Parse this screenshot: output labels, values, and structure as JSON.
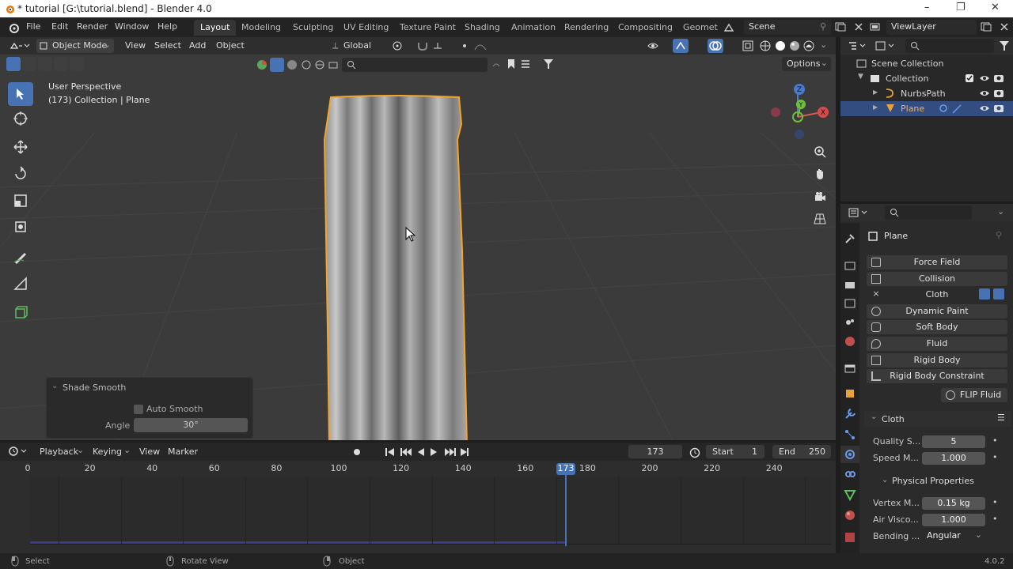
{
  "window": {
    "title": "* tutorial [G:\\tutorial.blend] - Blender 4.0",
    "controls": [
      "–",
      "❐",
      "✕"
    ]
  },
  "menubar": {
    "menus": [
      "File",
      "Edit",
      "Render",
      "Window",
      "Help"
    ],
    "workspaces": [
      "Layout",
      "Modeling",
      "Sculpting",
      "UV Editing",
      "Texture Paint",
      "Shading",
      "Animation",
      "Rendering",
      "Compositing",
      "Geomet"
    ],
    "active_workspace": "Layout",
    "scene": "Scene",
    "view_layer": "ViewLayer"
  },
  "viewport_header": {
    "mode": "Object Mode",
    "menus": [
      "View",
      "Select",
      "Add",
      "Object"
    ],
    "orientation": "Global",
    "options": "Options"
  },
  "viewport": {
    "perspective_label": "User Perspective",
    "collection_label": "(173) Collection | Plane",
    "gizmo_axes": {
      "x": "X",
      "y": "Y",
      "z": "Z"
    },
    "accent_color": "#4772b3",
    "selection_color": "#f5a42a"
  },
  "redo_panel": {
    "title": "Shade Smooth",
    "auto_smooth_label": "Auto Smooth",
    "auto_smooth_checked": false,
    "angle_label": "Angle",
    "angle_value": "30°"
  },
  "outliner": {
    "rows": [
      {
        "label": "Scene Collection",
        "type": "scene-collection"
      },
      {
        "label": "Collection",
        "type": "collection"
      },
      {
        "label": "NurbsPath",
        "type": "curve"
      },
      {
        "label": "Plane",
        "type": "mesh",
        "selected": true
      }
    ]
  },
  "properties": {
    "object_name": "Plane",
    "physics_buttons": [
      "Force Field",
      "Collision",
      "Cloth",
      "Dynamic Paint",
      "Soft Body",
      "Fluid",
      "Rigid Body",
      "Rigid Body Constraint"
    ],
    "flip_fluid": "FLIP Fluid",
    "cloth_panel": {
      "title": "Cloth",
      "quality_label": "Quality S...",
      "quality_value": "5",
      "speed_label": "Speed M...",
      "speed_value": "1.000",
      "physical_title": "Physical Properties",
      "vertex_label": "Vertex M...",
      "vertex_value": "0.15 kg",
      "air_label": "Air Visco...",
      "air_value": "1.000",
      "bending_label": "Bending ...",
      "bending_value": "Angular"
    }
  },
  "timeline": {
    "menus": [
      "Playback",
      "Keying",
      "View",
      "Marker"
    ],
    "current_frame": "173",
    "start_label": "Start",
    "start_value": "1",
    "end_label": "End",
    "end_value": "250",
    "ticks": [
      "0",
      "20",
      "40",
      "60",
      "80",
      "100",
      "120",
      "140",
      "160",
      "180",
      "200",
      "220",
      "240"
    ],
    "playhead": "173"
  },
  "statusbar": {
    "items": [
      "Select",
      "Rotate View",
      "Object"
    ],
    "version": "4.0.2"
  }
}
